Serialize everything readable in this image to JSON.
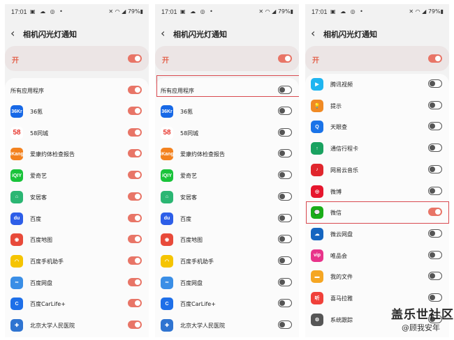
{
  "status": {
    "time": "17:01",
    "battery": "79%"
  },
  "header": {
    "title": "相机闪光灯通知",
    "back": "‹"
  },
  "master": {
    "label": "开",
    "on": true
  },
  "all_apps_label": "所有应用程序",
  "panel1": {
    "all_on": true,
    "apps": [
      {
        "name": "36氪",
        "icon_text": "36Kr",
        "color": "#1768e6",
        "on": true
      },
      {
        "name": "58同城",
        "icon_text": "58",
        "color": "#ffffff",
        "on": true
      },
      {
        "name": "爱康约体检查报告",
        "icon_text": "iKang",
        "color": "#f3821f",
        "on": true
      },
      {
        "name": "爱奇艺",
        "icon_text": "iQIY",
        "color": "#19c33a",
        "on": true
      },
      {
        "name": "安居客",
        "icon_text": "⌂",
        "color": "#2bb673",
        "on": true
      },
      {
        "name": "百度",
        "icon_text": "du",
        "color": "#2d5ee8",
        "on": true
      },
      {
        "name": "百度地图",
        "icon_text": "◉",
        "color": "#e84a3a",
        "on": true
      },
      {
        "name": "百度手机助手",
        "icon_text": "◠",
        "color": "#f5c400",
        "on": true
      },
      {
        "name": "百度网盘",
        "icon_text": "∞",
        "color": "#3a8ee6",
        "on": true
      },
      {
        "name": "百度CarLife+",
        "icon_text": "C",
        "color": "#1e6fe8",
        "on": true
      },
      {
        "name": "北京大学人民医院",
        "icon_text": "✚",
        "color": "#2f74d1",
        "on": true
      }
    ]
  },
  "panel2": {
    "all_on": false,
    "apps": [
      {
        "name": "36氪",
        "icon_text": "36Kr",
        "color": "#1768e6",
        "on": false
      },
      {
        "name": "58同城",
        "icon_text": "58",
        "color": "#ffffff",
        "on": false
      },
      {
        "name": "爱康约体检查报告",
        "icon_text": "iKang",
        "color": "#f3821f",
        "on": false
      },
      {
        "name": "爱奇艺",
        "icon_text": "iQIY",
        "color": "#19c33a",
        "on": false
      },
      {
        "name": "安居客",
        "icon_text": "⌂",
        "color": "#2bb673",
        "on": false
      },
      {
        "name": "百度",
        "icon_text": "du",
        "color": "#2d5ee8",
        "on": false
      },
      {
        "name": "百度地图",
        "icon_text": "◉",
        "color": "#e84a3a",
        "on": false
      },
      {
        "name": "百度手机助手",
        "icon_text": "◠",
        "color": "#f5c400",
        "on": false
      },
      {
        "name": "百度网盘",
        "icon_text": "∞",
        "color": "#3a8ee6",
        "on": false
      },
      {
        "name": "百度CarLife+",
        "icon_text": "C",
        "color": "#1e6fe8",
        "on": false
      },
      {
        "name": "北京大学人民医院",
        "icon_text": "✚",
        "color": "#2f74d1",
        "on": false
      }
    ]
  },
  "panel3": {
    "apps": [
      {
        "name": "腾讯视频",
        "icon_text": "▶",
        "color": "#1fb5f0",
        "on": false
      },
      {
        "name": "提示",
        "icon_text": "💡",
        "color": "#f08a24",
        "on": false
      },
      {
        "name": "天眼查",
        "icon_text": "Q",
        "color": "#1a73e8",
        "on": false
      },
      {
        "name": "通信行程卡",
        "icon_text": "↑",
        "color": "#1aa260",
        "on": false
      },
      {
        "name": "网易云音乐",
        "icon_text": "♪",
        "color": "#e0262d",
        "on": false
      },
      {
        "name": "微博",
        "icon_text": "◎",
        "color": "#e6162d",
        "on": false
      },
      {
        "name": "微信",
        "icon_text": "💬",
        "color": "#1aad19",
        "on": true
      },
      {
        "name": "微云网盘",
        "icon_text": "☁",
        "color": "#1565c0",
        "on": false
      },
      {
        "name": "唯品会",
        "icon_text": "vip",
        "color": "#e8338a",
        "on": false
      },
      {
        "name": "我的文件",
        "icon_text": "▬",
        "color": "#f5a623",
        "on": false
      },
      {
        "name": "喜马拉雅",
        "icon_text": "听",
        "color": "#f0403a",
        "on": false
      },
      {
        "name": "系统跟踪",
        "icon_text": "⚙",
        "color": "#555555",
        "on": false
      }
    ]
  },
  "watermark": {
    "brand": "盖乐世社区",
    "user": "@顾我安年"
  },
  "colors": {
    "accent": "#e87567",
    "highlight_box": "#d94a50"
  }
}
